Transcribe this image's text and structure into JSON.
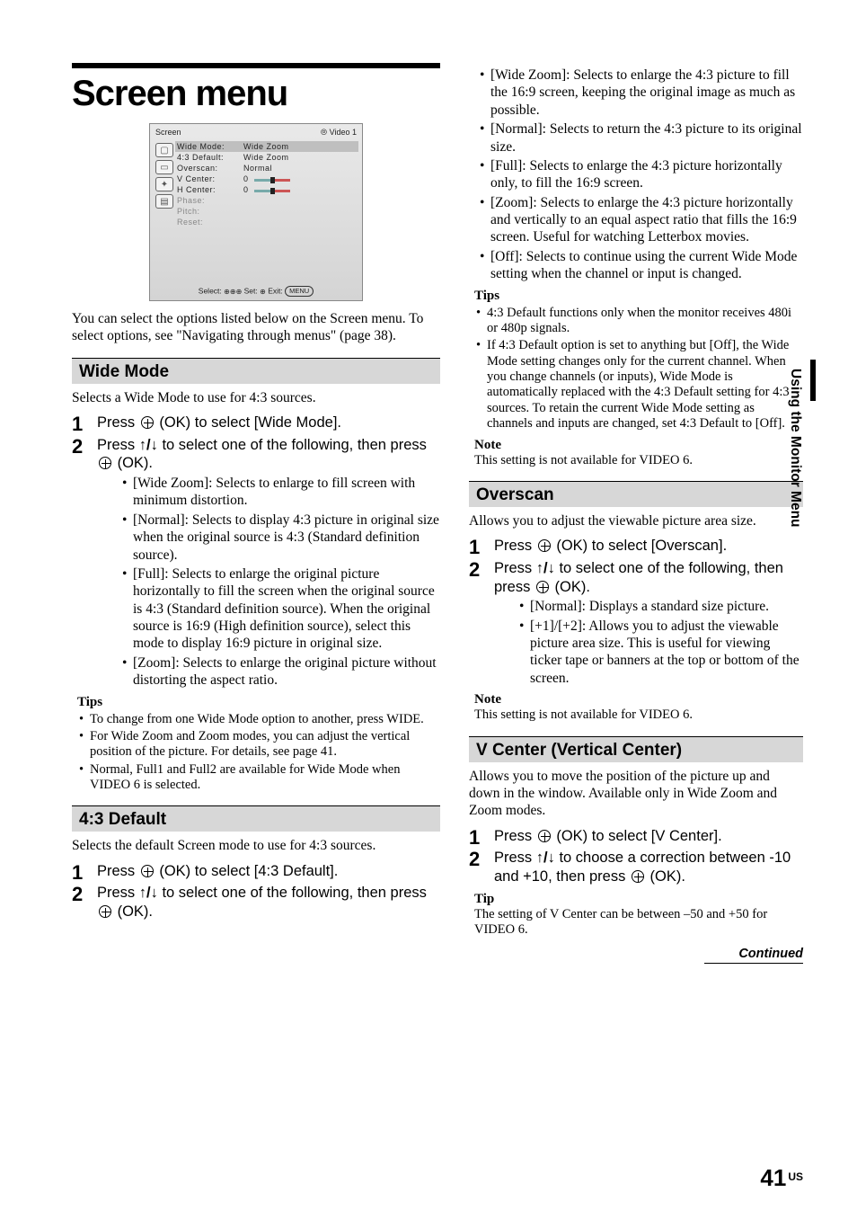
{
  "page": {
    "title": "Screen menu",
    "side_label": "Using the Monitor Menu",
    "page_number": "41",
    "page_suffix": "US",
    "continued": "Continued"
  },
  "osd": {
    "header_left": "Screen",
    "header_right": "Video 1",
    "rows": [
      {
        "label": "Wide  Mode:",
        "value": "Wide  Zoom",
        "sel": true
      },
      {
        "label": "4:3  Default:",
        "value": "Wide  Zoom"
      },
      {
        "label": "Overscan:",
        "value": "Normal"
      },
      {
        "label": "V  Center:",
        "value": "0",
        "slider": true
      },
      {
        "label": "H  Center:",
        "value": "0",
        "slider": true
      },
      {
        "label": "Phase:",
        "value": "",
        "dim": true
      },
      {
        "label": "Pitch:",
        "value": "",
        "dim": true
      },
      {
        "label": "Reset:",
        "value": "",
        "dim": true
      }
    ],
    "help_select": "Select:",
    "help_set": "Set:",
    "help_exit": "Exit:",
    "help_menu": "MENU"
  },
  "intro": "You can select the options listed below on the Screen menu. To select options, see \"Navigating through menus\" (page 38).",
  "wide_mode": {
    "heading": "Wide Mode",
    "lead": "Selects a Wide Mode to use for 4:3 sources.",
    "step1": "Press   (OK) to select [Wide Mode].",
    "step2a": "Press ",
    "step2_arrows": "↑/↓",
    "step2b": " to select one of the following, then press   (OK).",
    "opts": [
      "[Wide Zoom]: Selects to enlarge to fill screen with minimum distortion.",
      "[Normal]: Selects to display 4:3 picture in original size when the original source is 4:3 (Standard definition source).",
      "[Full]: Selects to enlarge the original picture horizontally to fill the screen when the original source is 4:3 (Standard definition source). When the original source is 16:9 (High definition source), select this mode to display 16:9 picture in original size.",
      "[Zoom]: Selects to enlarge the original picture without distorting the aspect ratio."
    ],
    "tips_h": "Tips",
    "tips": [
      "To change from one Wide Mode option to another, press WIDE.",
      "For Wide Zoom and Zoom modes, you can adjust the vertical position of the picture. For details, see page 41.",
      "Normal, Full1 and Full2 are available for Wide Mode when VIDEO 6 is selected."
    ]
  },
  "default43": {
    "heading": "4:3 Default",
    "lead": "Selects the default Screen mode to use for 4:3 sources.",
    "step1": "Press   (OK) to select [4:3 Default].",
    "step2a": "Press ",
    "step2_arrows": "↑/↓",
    "step2b": " to select one of the following, then press   (OK).",
    "opts": [
      "[Wide Zoom]: Selects to enlarge the 4:3 picture to fill the 16:9 screen, keeping the original image as much as possible.",
      "[Normal]: Selects to return the 4:3 picture to its original size.",
      "[Full]: Selects to enlarge the 4:3 picture horizontally only, to fill the 16:9 screen.",
      "[Zoom]: Selects to enlarge the 4:3 picture horizontally and vertically to an equal aspect ratio that fills the 16:9 screen. Useful for watching Letterbox movies.",
      "[Off]: Selects to continue using the current Wide Mode setting when the channel or input is changed."
    ],
    "tips_h": "Tips",
    "tips": [
      "4:3 Default functions only when the monitor receives 480i or 480p signals.",
      "If 4:3 Default option is set to anything but [Off], the Wide Mode setting changes only for the current channel. When you change channels (or inputs), Wide Mode is automatically replaced with the 4:3 Default setting for 4:3 sources. To retain the current Wide Mode setting as channels and inputs are changed, set 4:3 Default to [Off]."
    ],
    "note_h": "Note",
    "note": "This setting is not available for VIDEO 6."
  },
  "overscan": {
    "heading": "Overscan",
    "lead": "Allows you to adjust the viewable picture area size.",
    "step1": "Press   (OK) to select [Overscan].",
    "step2a": "Press ",
    "step2_arrows": "↑/↓",
    "step2b": " to select one of the following, then press   (OK).",
    "opts": [
      "[Normal]: Displays a standard size picture.",
      "[+1]/[+2]: Allows you to adjust the viewable picture area size. This is useful for viewing ticker tape or banners at the top or bottom of the screen."
    ],
    "note_h": "Note",
    "note": "This setting is not available for VIDEO 6."
  },
  "vcenter": {
    "heading": "V Center (Vertical Center)",
    "lead": "Allows you to move the position of the picture up and down in the window. Available only in Wide Zoom and Zoom modes.",
    "step1": "Press   (OK) to select [V Center].",
    "step2a": "Press ",
    "step2_arrows": "↑/↓",
    "step2b": " to choose a correction between -10 and +10, then press   (OK).",
    "tip_h": "Tip",
    "tip": "The setting of V Center can be between –50 and +50 for VIDEO 6."
  }
}
